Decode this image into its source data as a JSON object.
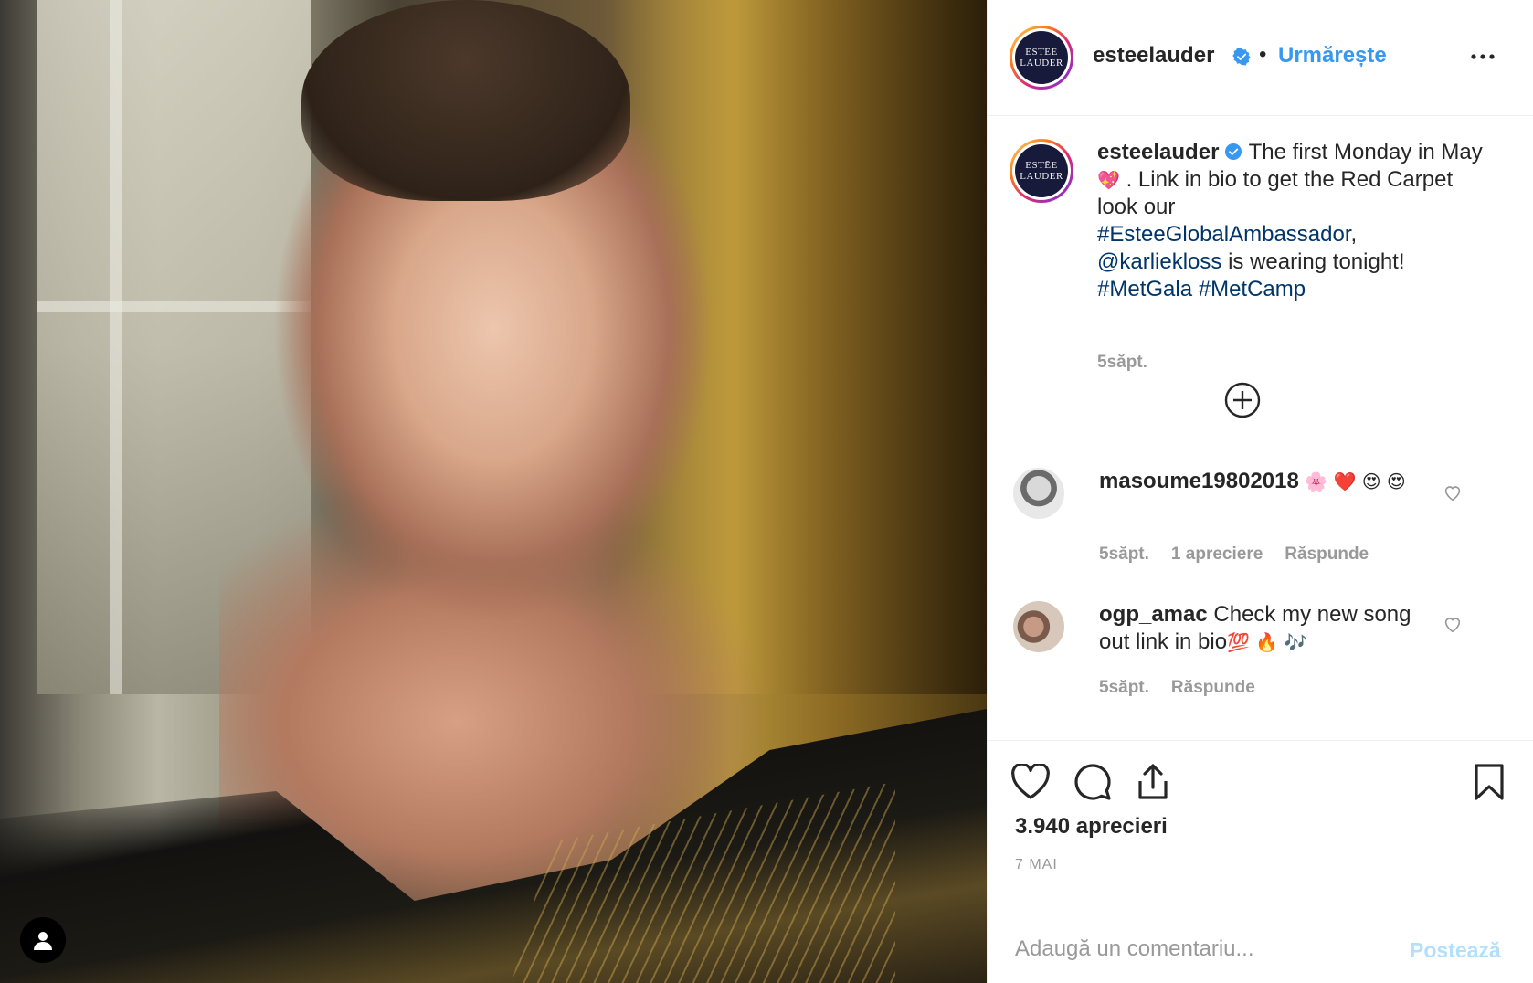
{
  "post": {
    "account": {
      "username": "esteelauder",
      "avatar_logo_line1": "ESTĒE",
      "avatar_logo_line2": "LAUDER",
      "follow_label": "Urmărește",
      "separator": "•"
    },
    "caption": {
      "username": "esteelauder",
      "text_before": " The first Monday in May ",
      "emoji_heart": "💖",
      "text_after": " . Link in bio to get the Red Carpet look our ",
      "hashtag_1": "#EsteeGlobalAmbassador",
      "comma": ",",
      "mention": "@karliekloss",
      "text_tonight": " is wearing tonight!",
      "hashtag_2": "#MetGala",
      "hashtag_3": "#MetCamp",
      "time": "5săpt."
    },
    "comments": [
      {
        "username": "masoume19802018",
        "emojis": " 🌸 ❤️ 😍 😍",
        "time": "5săpt.",
        "likes": "1 apreciere",
        "reply": "Răspunde"
      },
      {
        "username": "ogp_amac",
        "text": " Check my new song out link in bio",
        "emojis": "💯 🔥 🎶",
        "time": "5săpt.",
        "reply": "Răspunde"
      }
    ],
    "likes_count": "3.940 aprecieri",
    "date": "7 MAI",
    "add_comment_placeholder": "Adaugă un comentariu...",
    "post_button": "Postează"
  },
  "icons": {
    "verified": "verified-badge-icon",
    "more": "more-options-icon",
    "load_more": "plus-circle-icon",
    "like": "heart-icon",
    "comment": "comment-bubble-icon",
    "share": "share-icon",
    "save": "bookmark-icon",
    "user_tag": "user-icon"
  },
  "colors": {
    "accent": "#3897f0",
    "hashtag": "#003569",
    "muted": "#999999",
    "post_disabled": "#b2dffc",
    "text": "#262626"
  }
}
